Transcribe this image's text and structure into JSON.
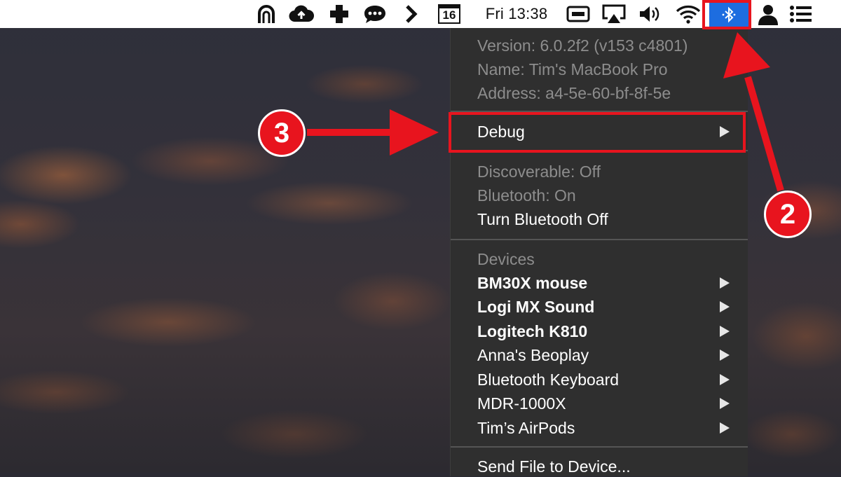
{
  "menubar": {
    "calendar_day": "16",
    "clock": "Fri 13:38",
    "icons": [
      "accessibility-icon",
      "cloud-upload-icon",
      "add-icon",
      "chat-icon",
      "chevron-right-icon",
      "calendar-icon",
      "display-icon",
      "airplay-icon",
      "volume-icon",
      "wifi-icon",
      "bluetooth-icon",
      "user-icon",
      "list-icon"
    ]
  },
  "bluetooth_menu": {
    "info": {
      "version": "Version: 6.0.2f2 (v153 c4801)",
      "name": "Name: Tim's MacBook Pro",
      "address": "Address: a4-5e-60-bf-8f-5e"
    },
    "debug": "Debug",
    "status": {
      "discoverable": "Discoverable: Off",
      "bluetooth": "Bluetooth: On",
      "toggle": "Turn Bluetooth Off"
    },
    "devices_header": "Devices",
    "devices": [
      {
        "label": "BM30X mouse"
      },
      {
        "label": "Logi MX Sound"
      },
      {
        "label": "Logitech K810"
      },
      {
        "label": "Anna's Beoplay"
      },
      {
        "label": "Bluetooth Keyboard"
      },
      {
        "label": "MDR-1000X"
      },
      {
        "label": "Tim’s AirPods"
      }
    ],
    "send_file": "Send File to Device..."
  },
  "annotations": {
    "step_2": "2",
    "step_3": "3",
    "color": "#e8141e"
  }
}
